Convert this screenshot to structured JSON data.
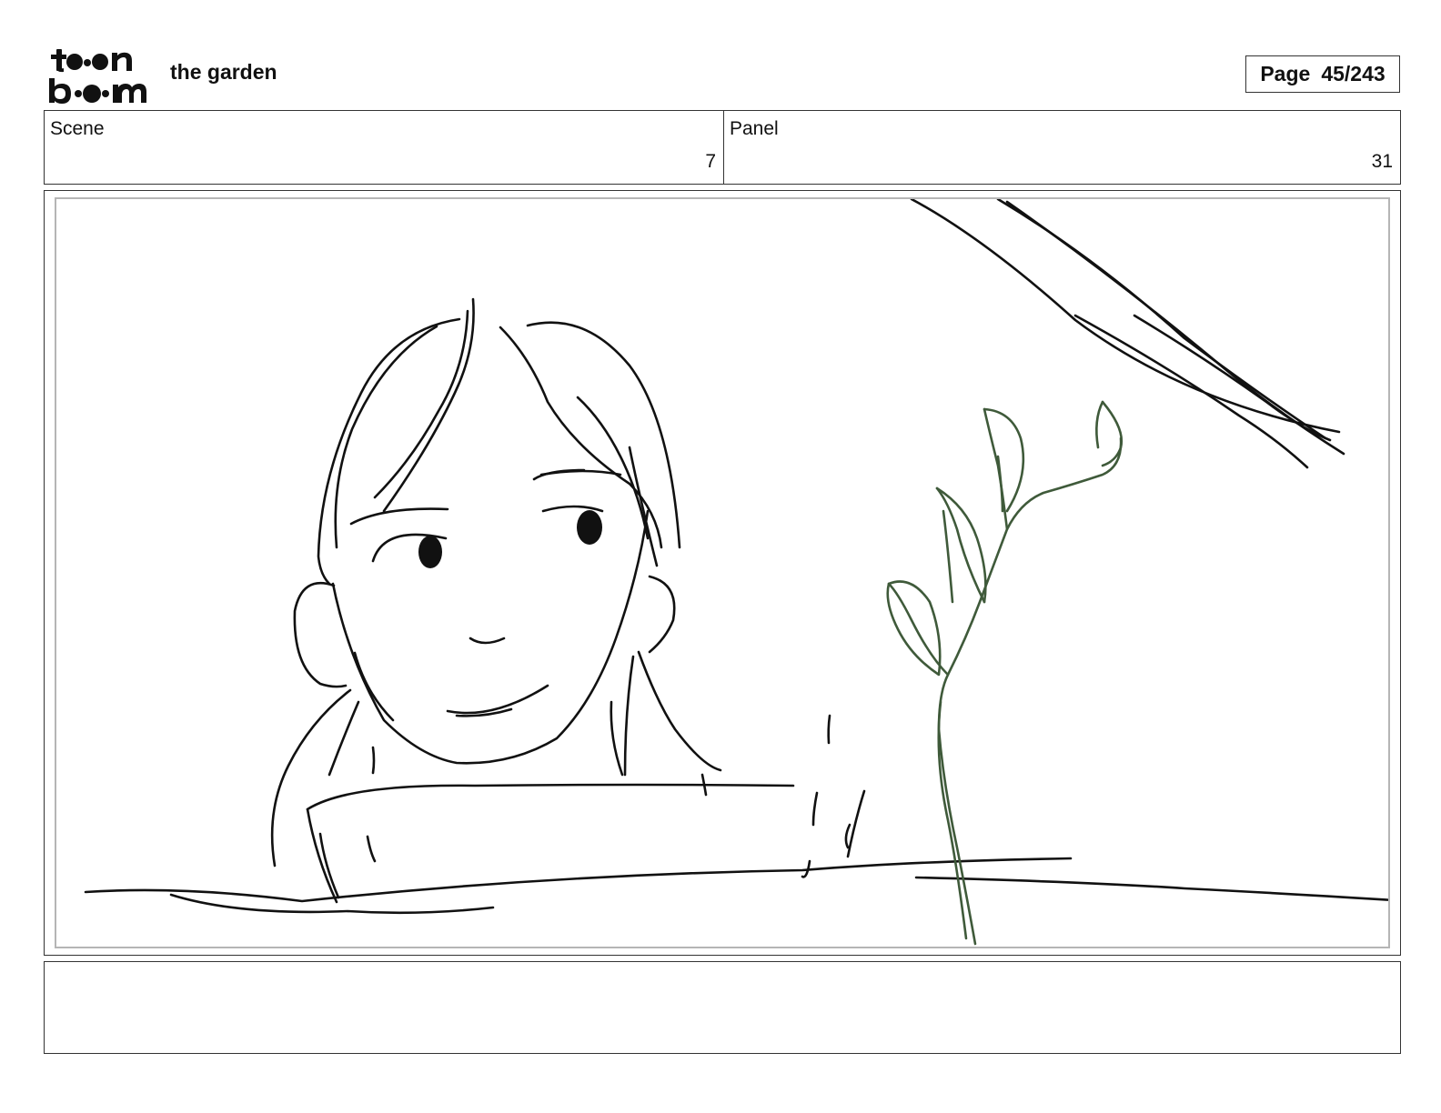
{
  "header": {
    "logo_alt": "toon boom",
    "project_title": "the garden",
    "page_label": "Page",
    "page_number": "45/243"
  },
  "info": {
    "scene_label": "Scene",
    "scene_value": "7",
    "panel_label": "Panel",
    "panel_value": "31"
  },
  "drawing": {
    "ink_color": "#111111",
    "plant_color": "#3f5a3a"
  },
  "notes": {
    "text": ""
  }
}
